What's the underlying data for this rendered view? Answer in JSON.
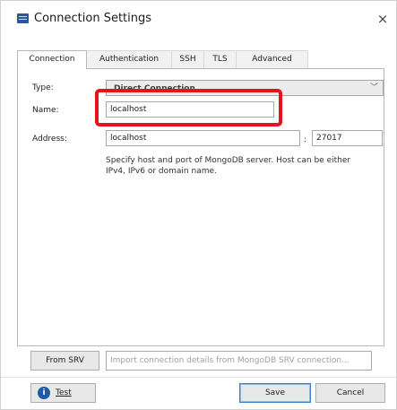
{
  "window": {
    "title": "Connection Settings",
    "close_glyph": "×"
  },
  "tabs": [
    {
      "label": "Connection",
      "active": true
    },
    {
      "label": "Authentication",
      "active": false
    },
    {
      "label": "SSH",
      "active": false
    },
    {
      "label": "TLS",
      "active": false
    },
    {
      "label": "Advanced",
      "active": false
    }
  ],
  "form": {
    "type_label": "Type:",
    "type_value": "Direct Connection",
    "name_label": "Name:",
    "name_value": "localhost",
    "address_label": "Address:",
    "host_value": "localhost",
    "port_separator": ":",
    "port_value": "27017",
    "help_text": "Specify host and port of MongoDB server. Host can be either IPv4, IPv6 or domain name."
  },
  "srv": {
    "button_label": "From SRV",
    "placeholder": "Import connection details from MongoDB SRV connection..."
  },
  "footer": {
    "test_label": "Test",
    "save_label": "Save",
    "cancel_label": "Cancel"
  },
  "colors": {
    "highlight": "#e3151a",
    "accent": "#1e5aa8"
  }
}
